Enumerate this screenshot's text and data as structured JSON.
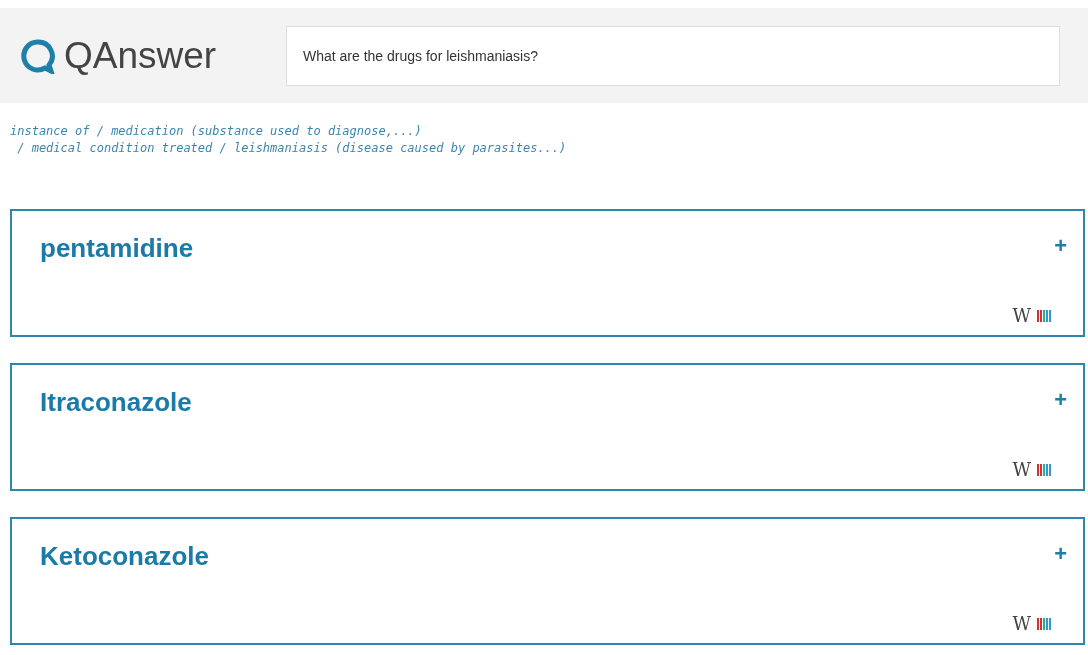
{
  "logo": {
    "text": "QAnswer"
  },
  "search": {
    "value": "What are the drugs for leishmaniasis?"
  },
  "query_path": [
    "instance of / medication (substance used to diagnose,...)",
    " / medical condition treated / leishmaniasis (disease caused by parasites...)"
  ],
  "results": [
    {
      "title": "pentamidine",
      "expand": "+",
      "wiki": "W"
    },
    {
      "title": "Itraconazole",
      "expand": "+",
      "wiki": "W"
    },
    {
      "title": "Ketoconazole",
      "expand": "+",
      "wiki": "W"
    }
  ]
}
